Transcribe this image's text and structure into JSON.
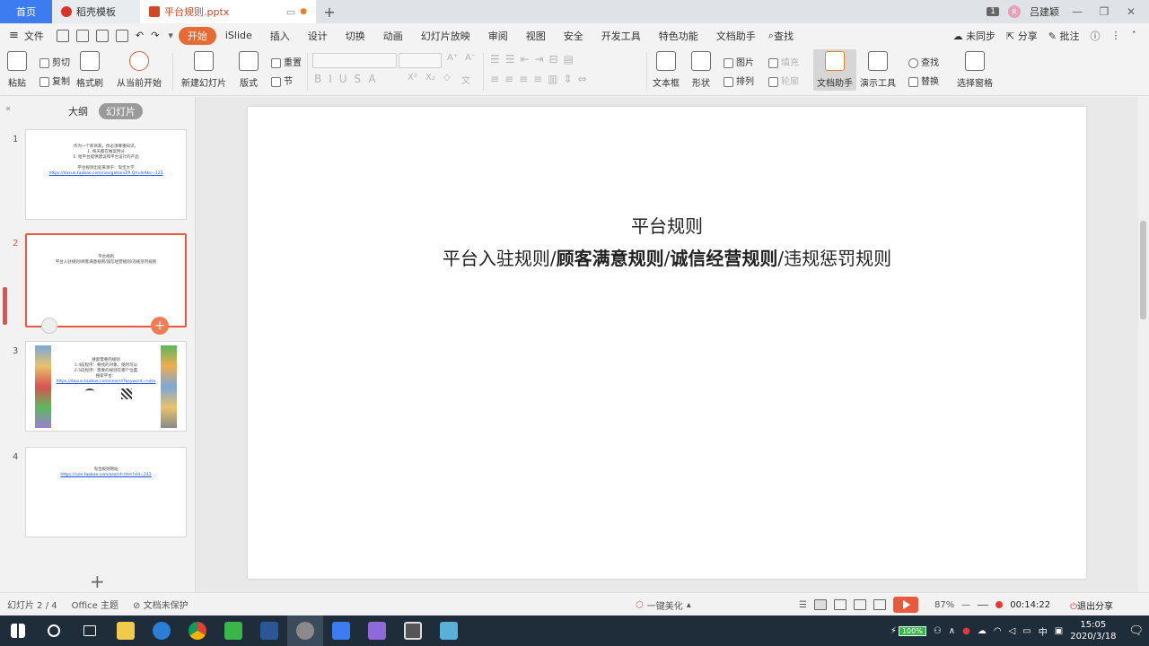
{
  "tabs": {
    "home": "首页",
    "daoke": "稻壳模板",
    "doc": "平台规则.pptx",
    "window_count": "1",
    "user": "吕建颖",
    "avatar_letter": "R"
  },
  "menu": {
    "file": "文件",
    "items": [
      "开始",
      "iSlide",
      "插入",
      "设计",
      "切换",
      "动画",
      "幻灯片放映",
      "审阅",
      "视图",
      "安全",
      "开发工具",
      "特色功能",
      "文档助手"
    ],
    "search": "查找",
    "sync": "未同步",
    "share": "分享",
    "comment": "批注"
  },
  "ribbon": {
    "paste": "粘贴",
    "cut": "剪切",
    "copy": "复制",
    "format_painter": "格式刷",
    "from_current": "从当前开始",
    "new_slide": "新建幻灯片",
    "layout": "版式",
    "reset": "重置",
    "section": "节",
    "textbox": "文本框",
    "shape": "形状",
    "picture": "图片",
    "arrange": "排列",
    "fill": "填充",
    "outline": "轮廓",
    "doc_assistant": "文档助手",
    "present_tools": "演示工具",
    "find": "查找",
    "replace": "替换",
    "selection_pane": "选择窗格"
  },
  "left_panel": {
    "outline_tab": "大纲",
    "slides_tab": "幻灯片",
    "slides": [
      {
        "num": "1",
        "lines": [
          "作为一个新商家，你必须尊重知识，",
          "1. 每天都在做案例分",
          "2. 给平台提供建议和平台设计的产品"
        ],
        "link_label": "平台规则出处来源于：淘宝大学",
        "link": "https://daxue.taobao.com/navigation/ZR.Q/ruleAbc=123"
      },
      {
        "num": "2",
        "lines": [
          "平台规则",
          "平台入驻规则/顾客满意规则/诚信经营规则/违规惩罚规则"
        ]
      },
      {
        "num": "3",
        "lines": [
          "搜索需要的规则",
          "1.4段程序：要找的对象，随时可以",
          "2.5段程序：需要的规则在哪个位置"
        ],
        "link_label": "搜索平台：",
        "link": "https://daxue.taobao.com/search?keyword=rules"
      },
      {
        "num": "4",
        "lines": [
          "淘宝规则网站"
        ],
        "link": "https://rule.taobao.com/search.htm?cId=213"
      }
    ]
  },
  "slide": {
    "title": "平台规则",
    "sub_parts": [
      {
        "text": "平台入驻规则/",
        "bold": false
      },
      {
        "text": "顾客满意规则",
        "bold": true
      },
      {
        "text": "/",
        "bold": false
      },
      {
        "text": "诚信经营规则",
        "bold": true
      },
      {
        "text": "/违规惩罚规则",
        "bold": false
      }
    ]
  },
  "status": {
    "slide_pos": "幻灯片 2 / 4",
    "theme": "Office 主题",
    "protect": "文档未保护",
    "beautify": "一键美化",
    "zoom": "87%",
    "timer": "00:14:22",
    "exit_share": "退出分享"
  },
  "taskbar": {
    "battery": "100%",
    "ime": "中",
    "time": "15:05",
    "date": "2020/3/18"
  }
}
